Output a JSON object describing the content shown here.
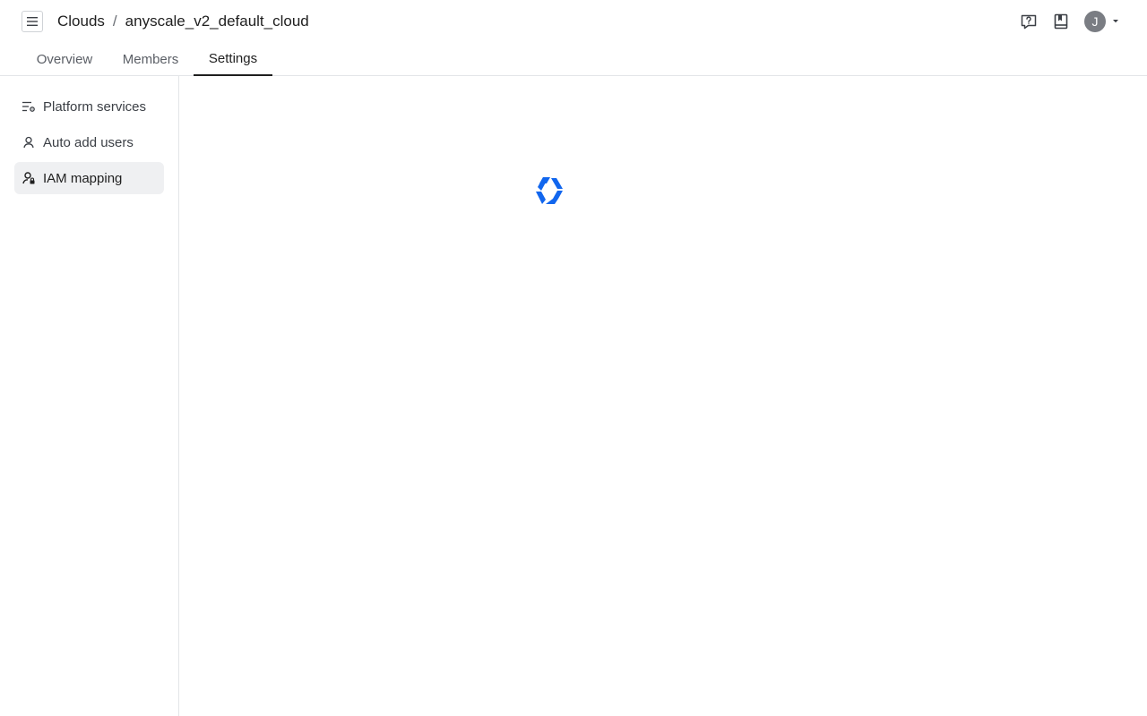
{
  "header": {
    "breadcrumb": {
      "root": "Clouds",
      "separator": "/",
      "current": "anyscale_v2_default_cloud"
    },
    "avatar_initial": "J",
    "icons": {
      "menu": "hamburger-menu-icon",
      "help": "help-question-icon",
      "docs": "bookmark-docs-icon",
      "caret": "caret-down-icon"
    }
  },
  "tabs": [
    {
      "label": "Overview",
      "active": false
    },
    {
      "label": "Members",
      "active": false
    },
    {
      "label": "Settings",
      "active": true
    }
  ],
  "sidebar": {
    "items": [
      {
        "label": "Platform services",
        "icon": "settings-list-icon",
        "active": false
      },
      {
        "label": "Auto add users",
        "icon": "user-icon",
        "active": false
      },
      {
        "label": "IAM mapping",
        "icon": "user-lock-icon",
        "active": true
      }
    ]
  },
  "content": {
    "state": "loading",
    "spinner_icon": "anyscale-logo-spinner-icon",
    "accent_color": "#1166ee"
  }
}
